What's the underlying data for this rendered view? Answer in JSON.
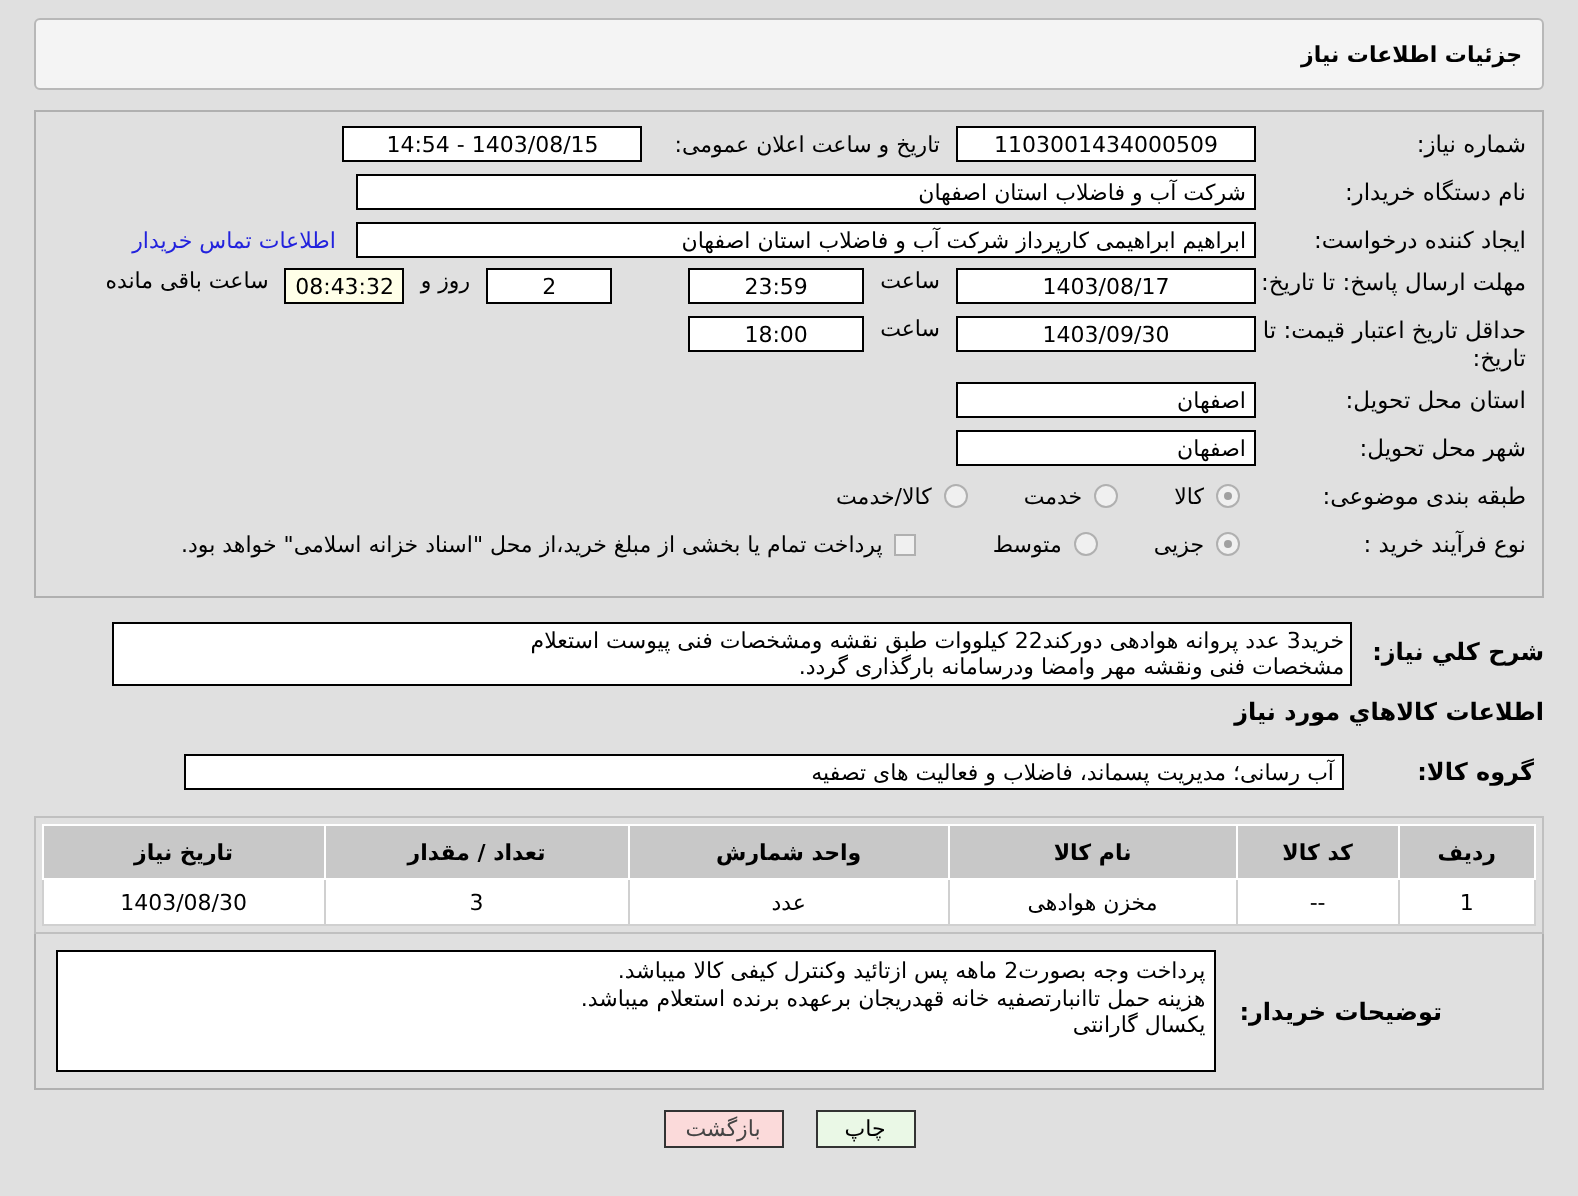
{
  "header": {
    "title": "جزئیات اطلاعات نیاز"
  },
  "need_number": {
    "label": "شماره نیاز:",
    "value": "1103001434000509"
  },
  "announce": {
    "label": "تاریخ و ساعت اعلان عمومی:",
    "value": "1403/08/15 - 14:54"
  },
  "buyer": {
    "label": "نام دستگاه خریدار:",
    "value": "شرکت آب و فاضلاب استان اصفهان"
  },
  "requester": {
    "label": "ایجاد کننده درخواست:",
    "value": "ابراهیم ابراهیمی کارپرداز شرکت آب و فاضلاب استان اصفهان",
    "link": "اطلاعات تماس خریدار"
  },
  "deadline": {
    "label": "مهلت ارسال پاسخ: تا تاریخ:",
    "date": "1403/08/17",
    "time_label": "ساعت",
    "time": "23:59",
    "days": "2",
    "days_label": "روز و",
    "remaining": "08:43:32",
    "remaining_label": "ساعت باقی مانده"
  },
  "validity": {
    "label": "حداقل تاریخ اعتبار قیمت: تا تاریخ:",
    "date": "1403/09/30",
    "time_label": "ساعت",
    "time": "18:00"
  },
  "province": {
    "label": "استان محل تحویل:",
    "value": "اصفهان"
  },
  "city": {
    "label": "شهر محل تحویل:",
    "value": "اصفهان"
  },
  "category": {
    "label": "طبقه بندی موضوعی:",
    "options": [
      {
        "label": "کالا",
        "selected": true
      },
      {
        "label": "خدمت",
        "selected": false
      },
      {
        "label": "کالا/خدمت",
        "selected": false
      }
    ]
  },
  "process": {
    "label": "نوع فرآیند خرید :",
    "options": [
      {
        "label": "جزیی",
        "selected": true
      },
      {
        "label": "متوسط",
        "selected": false
      }
    ],
    "payment": {
      "checked": false,
      "text": "پرداخت تمام یا بخشی از مبلغ خرید،از محل \"اسناد خزانه اسلامی\" خواهد بود."
    }
  },
  "description": {
    "label": "شرح کلي نياز:",
    "text": "خرید3 عدد پروانه هوادهی دورکند22 کیلووات طبق نقشه ومشخصات فنی پیوست استعلام\nمشخصات فنی ونقشه مهر وامضا ودرسامانه بارگذاری گردد."
  },
  "goods": {
    "title": "اطلاعات کالاهاي مورد نياز",
    "group_label": "گروه کالا:",
    "group_value": "آب رسانی؛ مدیریت پسماند، فاضلاب و فعالیت های تصفیه",
    "columns": [
      "ردیف",
      "کد کالا",
      "نام کالا",
      "واحد شمارش",
      "تعداد / مقدار",
      "تاریخ نیاز"
    ],
    "rows": [
      [
        "1",
        "--",
        "مخزن هوادهی",
        "عدد",
        "3",
        "1403/08/30"
      ]
    ]
  },
  "notes": {
    "label": "توضیحات خریدار:",
    "text": "پرداخت وجه بصورت2 ماهه پس ازتائید وکنترل کیفی کالا میباشد.\nهزینه حمل تاانبارتصفیه خانه قهدریجان برعهده برنده استعلام میباشد.\nیکسال گارانتی"
  },
  "buttons": [
    {
      "label": "چاپ",
      "kind": "print"
    },
    {
      "label": "بازگشت",
      "kind": "back"
    }
  ]
}
